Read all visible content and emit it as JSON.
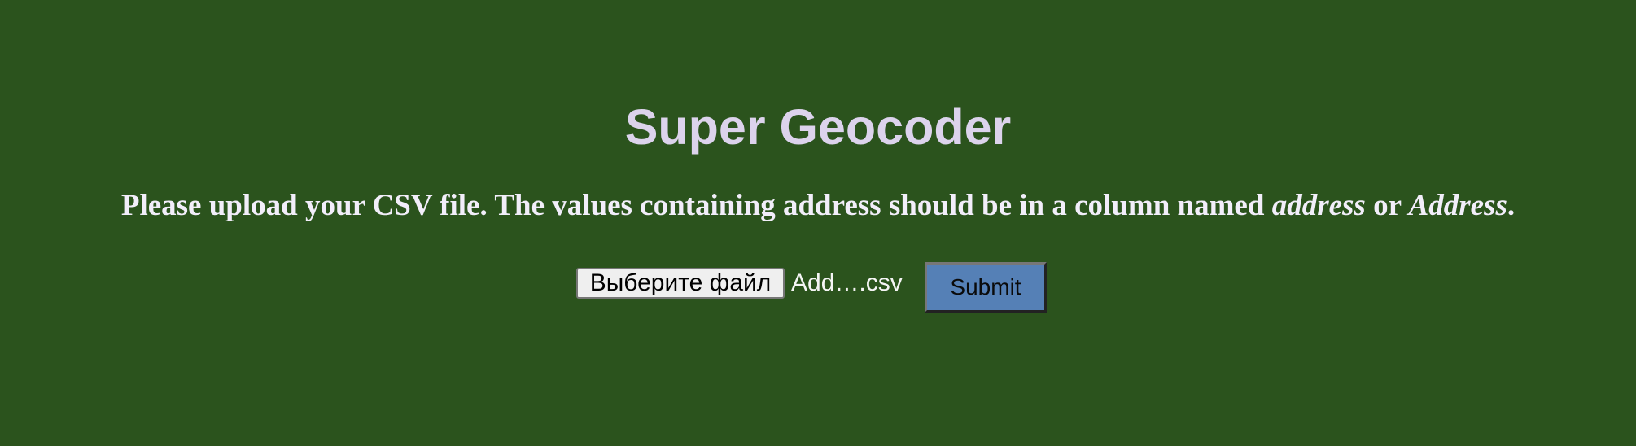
{
  "header": {
    "title": "Super Geocoder"
  },
  "instructions": {
    "text_before": "Please upload your CSV file. The values containing address should be in a column named ",
    "emphasis_1": "address",
    "text_middle": " or ",
    "emphasis_2": "Address",
    "text_after": "."
  },
  "upload_form": {
    "file_button_label": "Выберите файл",
    "selected_file_name": "Add….csv",
    "submit_label": "Submit"
  },
  "colors": {
    "background": "#2b531d",
    "title": "#dcd3ec",
    "instructions": "#f2eefa",
    "submit_button": "#5580b6",
    "file_button": "#efefef"
  }
}
